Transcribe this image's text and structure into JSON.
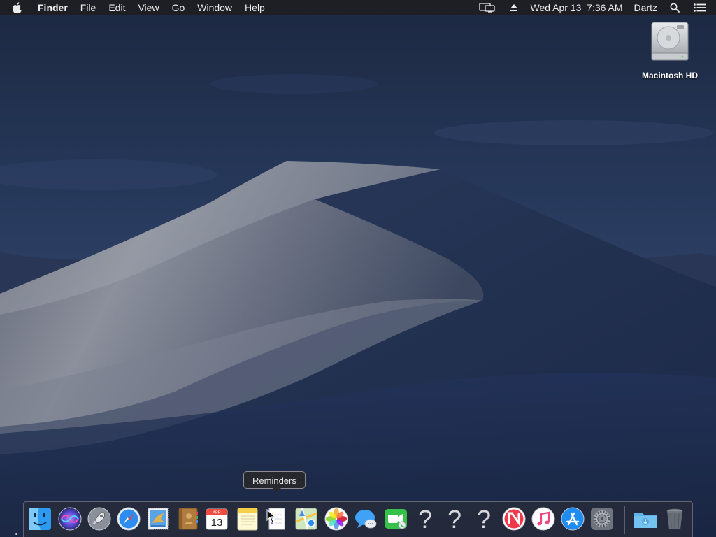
{
  "menubar": {
    "apple_icon": "apple-logo-icon",
    "app_name": "Finder",
    "menus": [
      "File",
      "Edit",
      "View",
      "Go",
      "Window",
      "Help"
    ],
    "status": {
      "display_icon": "airplay-display-icon",
      "eject_icon": "eject-icon",
      "datetime": "Wed Apr 13  7:36 AM",
      "user": "Dartz",
      "search_icon": "spotlight-search-icon",
      "notifications_icon": "notification-center-icon"
    }
  },
  "desktop": {
    "icons": [
      {
        "label": "Macintosh HD",
        "icon": "hard-drive-icon"
      }
    ]
  },
  "tooltip": {
    "text": "Reminders"
  },
  "dock": {
    "items": [
      {
        "name": "Finder",
        "icon": "finder-icon",
        "running": true
      },
      {
        "name": "Siri",
        "icon": "siri-icon"
      },
      {
        "name": "Launchpad",
        "icon": "launchpad-rocket-icon"
      },
      {
        "name": "Safari",
        "icon": "safari-compass-icon"
      },
      {
        "name": "Mail",
        "icon": "mail-stamp-icon"
      },
      {
        "name": "Contacts",
        "icon": "contacts-book-icon"
      },
      {
        "name": "Calendar",
        "icon": "calendar-icon",
        "month": "APR",
        "day": "13"
      },
      {
        "name": "Notes",
        "icon": "notes-icon"
      },
      {
        "name": "Reminders",
        "icon": "reminders-icon"
      },
      {
        "name": "Maps",
        "icon": "maps-icon"
      },
      {
        "name": "Photos",
        "icon": "photos-flower-icon"
      },
      {
        "name": "Messages",
        "icon": "messages-bubble-icon"
      },
      {
        "name": "FaceTime",
        "icon": "facetime-camera-icon"
      },
      {
        "name": "Unknown",
        "icon": "question-mark-icon",
        "glyph": "?"
      },
      {
        "name": "Unknown",
        "icon": "question-mark-icon",
        "glyph": "?"
      },
      {
        "name": "Unknown",
        "icon": "question-mark-icon",
        "glyph": "?"
      },
      {
        "name": "News",
        "icon": "news-icon"
      },
      {
        "name": "iTunes",
        "icon": "itunes-music-note-icon"
      },
      {
        "name": "App Store",
        "icon": "app-store-icon"
      },
      {
        "name": "System Preferences",
        "icon": "system-preferences-gear-icon"
      },
      {
        "name": "Downloads",
        "icon": "downloads-folder-icon"
      },
      {
        "name": "Trash",
        "icon": "trash-icon"
      }
    ]
  },
  "colors": {
    "menubar_bg": "#1e1e22",
    "sky_top": "#1d2b45",
    "dune_light": "#9a9fab",
    "dune_shadow": "#1f2d4e",
    "accent_blue": "#1e8cf0"
  }
}
